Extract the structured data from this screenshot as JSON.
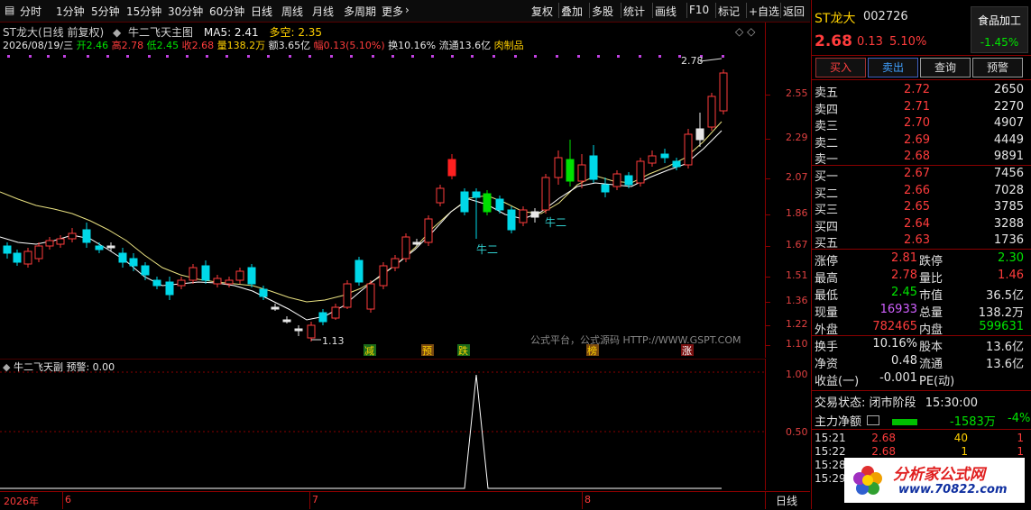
{
  "toolbar": {
    "left_items": [
      "分时",
      "1分钟",
      "5分钟",
      "15分钟",
      "30分钟",
      "60分钟",
      "日线",
      "周线",
      "月线",
      "多周期",
      "更多"
    ],
    "active": "日线",
    "right_items": [
      "复权",
      "叠加",
      "多股",
      "统计",
      "画线",
      "F10",
      "标记",
      "+自选",
      "返回"
    ]
  },
  "main_chart": {
    "title": "ST龙大(日线 前复权)",
    "indicator": "牛二飞天主图",
    "ma5": "MA5: 2.41",
    "duokong": "多空: 2.35",
    "info": {
      "date": "2026/08/19/三",
      "open": "开2.46",
      "high": "高2.78",
      "low": "低2.45",
      "close": "收2.68",
      "vol": "量138.2万",
      "amount": "额3.65亿",
      "range": "幅0.13(5.10%)",
      "turnover": "换10.16%",
      "float": "流通13.6亿",
      "industry": "肉制品"
    },
    "price_axis": [
      "2.55",
      "2.29",
      "2.07",
      "1.86",
      "1.67",
      "1.51",
      "1.36",
      "1.22",
      "1.10"
    ],
    "annotations": {
      "high_label": "2.78",
      "low_label": "1.13",
      "niu_er_1": "牛二",
      "niu_er_2": "牛二",
      "mark_jian": "减",
      "mark_yu": "预",
      "mark_die": "跌",
      "mark_bang": "榜",
      "mark_zhang": "涨",
      "source": "公式平台，公式源码 HTTP://WWW.GSPT.COM"
    }
  },
  "sub_chart": {
    "title": "牛二飞天副",
    "warning": "预警: 0.00",
    "axis": [
      "1.00",
      "0.50"
    ]
  },
  "time_axis": {
    "labels": [
      "2026年",
      "6",
      "7",
      "8"
    ],
    "period": "日线"
  },
  "panel": {
    "name": "ST龙大",
    "code": "002726",
    "sector": "食品加工",
    "sector_change": "-1.45%",
    "price": "2.68",
    "change": "0.13",
    "change_pct": "5.10%",
    "buttons": [
      "买入",
      "卖出",
      "查询",
      "预警"
    ],
    "sell_rows": [
      {
        "label": "卖五",
        "price": "2.72",
        "vol": "2650"
      },
      {
        "label": "卖四",
        "price": "2.71",
        "vol": "2270"
      },
      {
        "label": "卖三",
        "price": "2.70",
        "vol": "4907"
      },
      {
        "label": "卖二",
        "price": "2.69",
        "vol": "4449"
      },
      {
        "label": "卖一",
        "price": "2.68",
        "vol": "9891"
      }
    ],
    "buy_rows": [
      {
        "label": "买一",
        "price": "2.67",
        "vol": "7456"
      },
      {
        "label": "买二",
        "price": "2.66",
        "vol": "7028"
      },
      {
        "label": "买三",
        "price": "2.65",
        "vol": "3785"
      },
      {
        "label": "买四",
        "price": "2.64",
        "vol": "3288"
      },
      {
        "label": "买五",
        "price": "2.63",
        "vol": "1736"
      }
    ],
    "stats": [
      {
        "l1": "涨停",
        "v1": "2.81",
        "c1": "red",
        "l2": "跌停",
        "v2": "2.30",
        "c2": "green"
      },
      {
        "l1": "最高",
        "v1": "2.78",
        "c1": "red",
        "l2": "量比",
        "v2": "1.46",
        "c2": "red"
      },
      {
        "l1": "最低",
        "v1": "2.45",
        "c1": "green",
        "l2": "市值",
        "v2": "36.5亿",
        "c2": "white"
      },
      {
        "l1": "现量",
        "v1": "16933",
        "c1": "purple",
        "l2": "总量",
        "v2": "138.2万",
        "c2": "white"
      },
      {
        "l1": "外盘",
        "v1": "782465",
        "c1": "red",
        "l2": "内盘",
        "v2": "599631",
        "c2": "green"
      }
    ],
    "stats2": [
      {
        "l1": "换手",
        "v1": "10.16%",
        "l2": "股本",
        "v2": "13.6亿"
      },
      {
        "l1": "净资",
        "v1": "0.48",
        "l2": "流通",
        "v2": "13.6亿"
      },
      {
        "l1": "收益(一)",
        "v1": "-0.001",
        "l2": "PE(动)",
        "v2": ""
      }
    ],
    "trade_status_label": "交易状态:",
    "trade_status": "闭市阶段",
    "trade_time": "15:30:00",
    "main_flow_label": "主力净额",
    "main_flow": "-1583万",
    "main_flow_pct": "-4%",
    "ticks": [
      {
        "time": "15:21",
        "price": "2.68",
        "vol": "40",
        "dir": "1"
      },
      {
        "time": "15:22",
        "price": "2.68",
        "vol": "1",
        "dir": "1"
      },
      {
        "time": "15:28",
        "price": "",
        "vol": "",
        "dir": ""
      },
      {
        "time": "15:29",
        "price": "",
        "vol": "",
        "dir": ""
      }
    ],
    "logo_text": "分析家公式网",
    "logo_url": "www.70822.com"
  },
  "colors": {
    "up": "#ff3c3c",
    "down": "#00e0e0",
    "ma_yellow": "#e8e080",
    "ma_white": "#ffffff",
    "grid": "#8a0000"
  }
}
